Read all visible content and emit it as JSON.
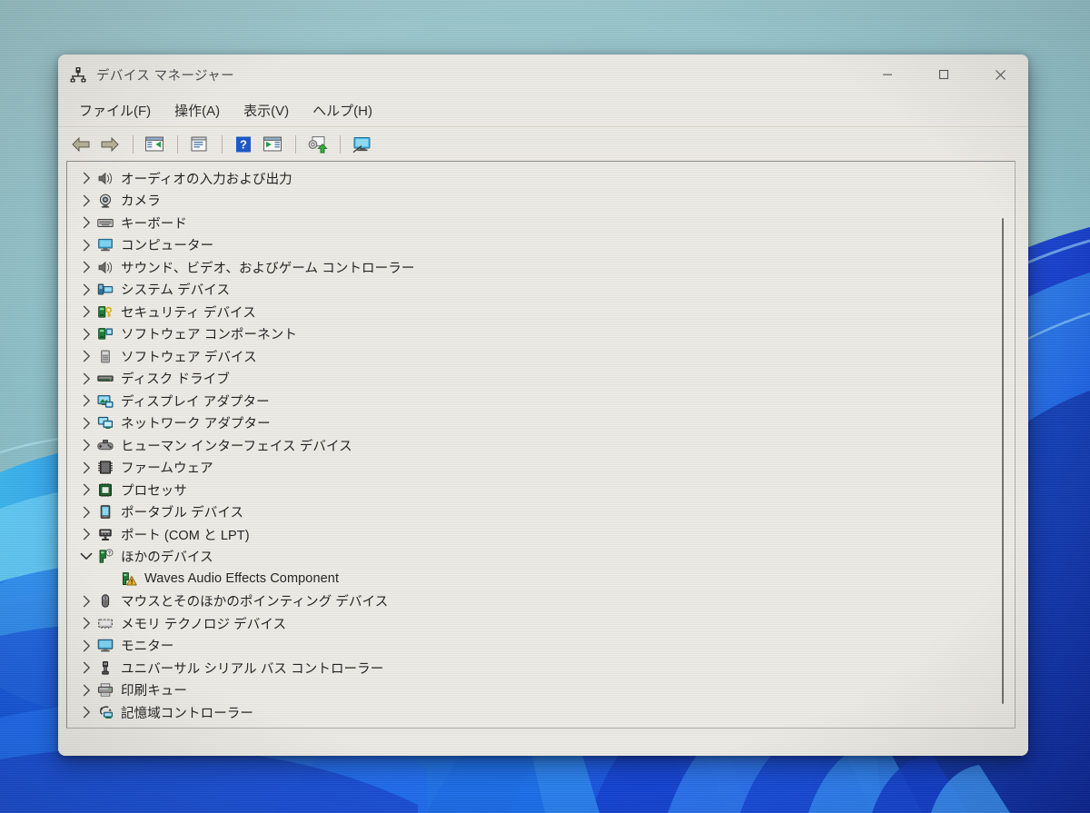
{
  "window": {
    "title": "デバイス マネージャー",
    "title_icon": "device-manager-icon",
    "controls": {
      "minimize": "minimize-icon",
      "maximize": "maximize-icon",
      "close": "close-icon"
    }
  },
  "menubar": {
    "items": [
      {
        "label": "ファイル(F)",
        "name": "menu-file"
      },
      {
        "label": "操作(A)",
        "name": "menu-action"
      },
      {
        "label": "表示(V)",
        "name": "menu-view"
      },
      {
        "label": "ヘルプ(H)",
        "name": "menu-help"
      }
    ]
  },
  "toolbar": {
    "buttons": [
      {
        "icon": "back-arrow-icon",
        "title": "戻る"
      },
      {
        "icon": "forward-arrow-icon",
        "title": "進む"
      },
      {
        "icon": "show-hide-console-tree-icon",
        "title": "コンソール ツリーの表示/非表示"
      },
      {
        "icon": "properties-icon",
        "title": "プロパティ"
      },
      {
        "icon": "help-icon",
        "title": "ヘルプ"
      },
      {
        "icon": "scan-hardware-changes-icon",
        "title": "ハードウェア変更のスキャン"
      },
      {
        "icon": "update-driver-icon",
        "title": "ドライバーの更新"
      },
      {
        "icon": "show-devices-icon",
        "title": "デバイスの表示"
      }
    ]
  },
  "tree": {
    "scrollbar": {
      "name": "vertical-scrollbar"
    },
    "rows": [
      {
        "label": "オーディオの入力および出力",
        "icon": "speaker-icon",
        "depth": 1,
        "expander": "collapsed"
      },
      {
        "label": "カメラ",
        "icon": "camera-icon",
        "depth": 1,
        "expander": "collapsed"
      },
      {
        "label": "キーボード",
        "icon": "keyboard-icon",
        "depth": 1,
        "expander": "collapsed"
      },
      {
        "label": "コンピューター",
        "icon": "computer-icon",
        "depth": 1,
        "expander": "collapsed"
      },
      {
        "label": "サウンド、ビデオ、およびゲーム コントローラー",
        "icon": "speaker-icon",
        "depth": 1,
        "expander": "collapsed"
      },
      {
        "label": "システム デバイス",
        "icon": "system-device-icon",
        "depth": 1,
        "expander": "collapsed"
      },
      {
        "label": "セキュリティ デバイス",
        "icon": "security-device-icon",
        "depth": 1,
        "expander": "collapsed"
      },
      {
        "label": "ソフトウェア コンポーネント",
        "icon": "software-component-icon",
        "depth": 1,
        "expander": "collapsed"
      },
      {
        "label": "ソフトウェア デバイス",
        "icon": "software-device-icon",
        "depth": 1,
        "expander": "collapsed"
      },
      {
        "label": "ディスク ドライブ",
        "icon": "disk-drive-icon",
        "depth": 1,
        "expander": "collapsed"
      },
      {
        "label": "ディスプレイ アダプター",
        "icon": "display-adapter-icon",
        "depth": 1,
        "expander": "collapsed"
      },
      {
        "label": "ネットワーク アダプター",
        "icon": "network-adapter-icon",
        "depth": 1,
        "expander": "collapsed"
      },
      {
        "label": "ヒューマン インターフェイス デバイス",
        "icon": "hid-gamepad-icon",
        "depth": 1,
        "expander": "collapsed"
      },
      {
        "label": "ファームウェア",
        "icon": "firmware-chip-icon",
        "depth": 1,
        "expander": "collapsed"
      },
      {
        "label": "プロセッサ",
        "icon": "processor-icon",
        "depth": 1,
        "expander": "collapsed"
      },
      {
        "label": "ポータブル デバイス",
        "icon": "portable-device-icon",
        "depth": 1,
        "expander": "collapsed"
      },
      {
        "label": "ポート (COM と LPT)",
        "icon": "port-icon",
        "depth": 1,
        "expander": "collapsed"
      },
      {
        "label": "ほかのデバイス",
        "icon": "other-device-question-icon",
        "depth": 1,
        "expander": "expanded"
      },
      {
        "label": "Waves Audio Effects Component",
        "icon": "unknown-device-warning-icon",
        "depth": 2,
        "expander": "none"
      },
      {
        "label": "マウスとそのほかのポインティング デバイス",
        "icon": "mouse-icon",
        "depth": 1,
        "expander": "collapsed"
      },
      {
        "label": "メモリ テクノロジ デバイス",
        "icon": "memory-technology-icon",
        "depth": 1,
        "expander": "collapsed"
      },
      {
        "label": "モニター",
        "icon": "monitor-icon",
        "depth": 1,
        "expander": "collapsed"
      },
      {
        "label": "ユニバーサル シリアル バス コントローラー",
        "icon": "usb-icon",
        "depth": 1,
        "expander": "collapsed"
      },
      {
        "label": "印刷キュー",
        "icon": "printer-icon",
        "depth": 1,
        "expander": "collapsed"
      },
      {
        "label": "記憶域コントローラー",
        "icon": "storage-controller-icon",
        "depth": 1,
        "expander": "collapsed"
      }
    ]
  },
  "colors": {
    "window_bg": "#eceae4",
    "panel_bg": "#eeece6",
    "desktop_top": "#8fc0c8",
    "accent_blue": "#1a4fe0",
    "warning_yellow": "#f0b323",
    "help_blue": "#1856c8"
  }
}
